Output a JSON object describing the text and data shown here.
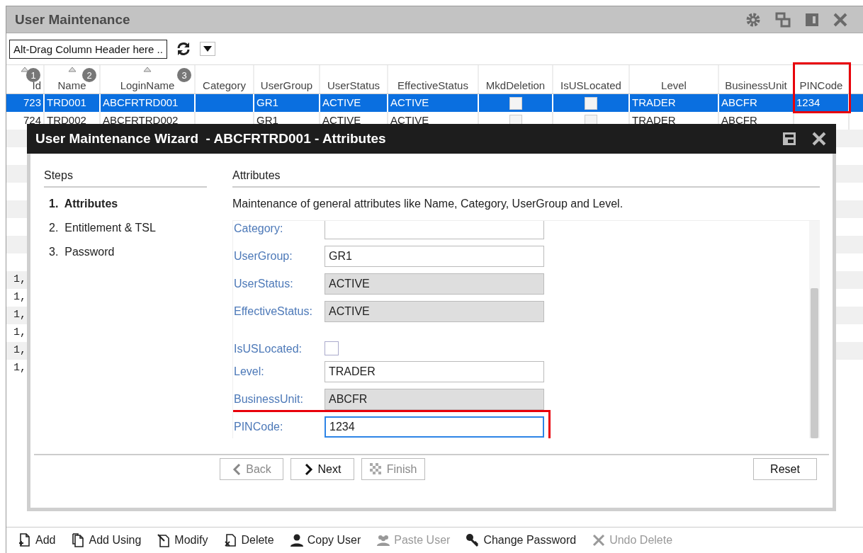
{
  "window": {
    "title": "User Maintenance"
  },
  "toolbar": {
    "group_by_hint": "Alt-Drag Column Header here .."
  },
  "grid": {
    "columns": [
      {
        "label": "Id",
        "kind": "num",
        "sorted": true,
        "sort_order": "1",
        "highlighted": false
      },
      {
        "label": "Name",
        "kind": "text",
        "sorted": true,
        "sort_order": "2",
        "highlighted": false
      },
      {
        "label": "LoginName",
        "kind": "text",
        "sorted": true,
        "sort_order": "3",
        "highlighted": false
      },
      {
        "label": "Category",
        "kind": "text",
        "sorted": false,
        "highlighted": false
      },
      {
        "label": "UserGroup",
        "kind": "text",
        "sorted": false,
        "highlighted": false
      },
      {
        "label": "UserStatus",
        "kind": "text",
        "sorted": false,
        "highlighted": false
      },
      {
        "label": "EffectiveStatus",
        "kind": "text",
        "sorted": false,
        "highlighted": false
      },
      {
        "label": "MkdDeletion",
        "kind": "check",
        "sorted": false,
        "highlighted": false
      },
      {
        "label": "IsUSLocated",
        "kind": "check",
        "sorted": false,
        "highlighted": false
      },
      {
        "label": "Level",
        "kind": "text",
        "sorted": false,
        "highlighted": false
      },
      {
        "label": "BusinessUnit",
        "kind": "text",
        "sorted": false,
        "highlighted": false
      },
      {
        "label": "PINCode",
        "kind": "text",
        "sorted": false,
        "highlighted": true
      }
    ],
    "rows": [
      {
        "kind": "full",
        "selected": true,
        "cells": [
          {
            "kind": "text",
            "value": "723"
          },
          {
            "kind": "text",
            "value": "TRD001"
          },
          {
            "kind": "text",
            "value": "ABCFRTRD001"
          },
          {
            "kind": "blank"
          },
          {
            "kind": "text",
            "value": "GR1"
          },
          {
            "kind": "text",
            "value": "ACTIVE"
          },
          {
            "kind": "text",
            "value": "ACTIVE"
          },
          {
            "kind": "check",
            "checked": false
          },
          {
            "kind": "check",
            "checked": false
          },
          {
            "kind": "text",
            "value": "TRADER"
          },
          {
            "kind": "text",
            "value": "ABCFR"
          },
          {
            "kind": "text",
            "value": "1234"
          }
        ]
      },
      {
        "kind": "full",
        "selected": false,
        "cells": [
          {
            "kind": "text",
            "value": "724"
          },
          {
            "kind": "text",
            "value": "TRD002"
          },
          {
            "kind": "text",
            "value": "ABCFRTRD002"
          },
          {
            "kind": "blank"
          },
          {
            "kind": "text",
            "value": "GR1"
          },
          {
            "kind": "text",
            "value": "ACTIVE"
          },
          {
            "kind": "text",
            "value": "ACTIVE"
          },
          {
            "kind": "check",
            "checked": false
          },
          {
            "kind": "check",
            "checked": false
          },
          {
            "kind": "text",
            "value": "TRADER"
          },
          {
            "kind": "text",
            "value": "ABCFR"
          },
          {
            "kind": "blank"
          }
        ]
      },
      {
        "kind": "covered",
        "selected": false
      },
      {
        "kind": "covered",
        "selected": false
      },
      {
        "kind": "covered",
        "selected": false
      },
      {
        "kind": "covered",
        "selected": false
      },
      {
        "kind": "covered",
        "selected": false
      },
      {
        "kind": "covered",
        "selected": false
      },
      {
        "kind": "covered",
        "selected": false
      },
      {
        "kind": "covered",
        "selected": false
      },
      {
        "kind": "partial",
        "selected": false,
        "id": "1,"
      },
      {
        "kind": "partial",
        "selected": false,
        "id": "1,"
      },
      {
        "kind": "partial",
        "selected": false,
        "id": "1,"
      },
      {
        "kind": "partial",
        "selected": false,
        "id": "1,"
      },
      {
        "kind": "partial",
        "selected": false,
        "id": "1,"
      },
      {
        "kind": "partial",
        "selected": false,
        "id": "1,"
      }
    ]
  },
  "wizard": {
    "title": "User Maintenance Wizard  - ABCFRTRD001 - Attributes",
    "steps_heading": "Steps",
    "steps": [
      {
        "label": "1.  Attributes",
        "selected": true
      },
      {
        "label": "2.  Entitlement & TSL",
        "selected": false
      },
      {
        "label": "3.  Password",
        "selected": false
      }
    ],
    "page_heading": "Attributes",
    "description": "Maintenance of general attributes like Name, Category, UserGroup and Level.",
    "fields": [
      {
        "label": "Category:",
        "kind": "text",
        "focused": false,
        "highlighted": false
      },
      {
        "label": "UserGroup:",
        "kind": "text",
        "value": "GR1",
        "focused": false,
        "highlighted": false
      },
      {
        "label": "UserStatus:",
        "kind": "readonly",
        "value": "ACTIVE",
        "focused": false,
        "highlighted": false
      },
      {
        "label": "EffectiveStatus:",
        "kind": "readonly",
        "value": "ACTIVE",
        "focused": false,
        "highlighted": false
      },
      {
        "label": "IsUSLocated:",
        "kind": "checkbox",
        "checked": false,
        "highlighted": false
      },
      {
        "label": "Level:",
        "kind": "text",
        "value": "TRADER",
        "focused": false,
        "highlighted": false
      },
      {
        "label": "BusinessUnit:",
        "kind": "readonly",
        "value": "ABCFR",
        "focused": false,
        "highlighted": false
      },
      {
        "label": "PINCode:",
        "kind": "text",
        "value": "1234",
        "focused": true,
        "highlighted": true
      }
    ],
    "nav_buttons": [
      {
        "label": "Back",
        "kind": "back",
        "disabled": true
      },
      {
        "label": "Next",
        "kind": "next",
        "disabled": false
      },
      {
        "label": "Finish",
        "kind": "finish",
        "disabled": true
      }
    ],
    "reset_button": "Reset"
  },
  "actions": [
    {
      "label": "Add",
      "kind": "add",
      "disabled": false
    },
    {
      "label": "Add Using",
      "kind": "copy",
      "disabled": false
    },
    {
      "label": "Modify",
      "kind": "modify",
      "disabled": false
    },
    {
      "label": "Delete",
      "kind": "delete",
      "disabled": false
    },
    {
      "label": "Copy User",
      "kind": "user",
      "disabled": false
    },
    {
      "label": "Paste User",
      "kind": "users",
      "disabled": true
    },
    {
      "label": "Change Password",
      "kind": "key",
      "disabled": false
    },
    {
      "label": "Undo Delete",
      "kind": "undo",
      "disabled": true
    }
  ]
}
